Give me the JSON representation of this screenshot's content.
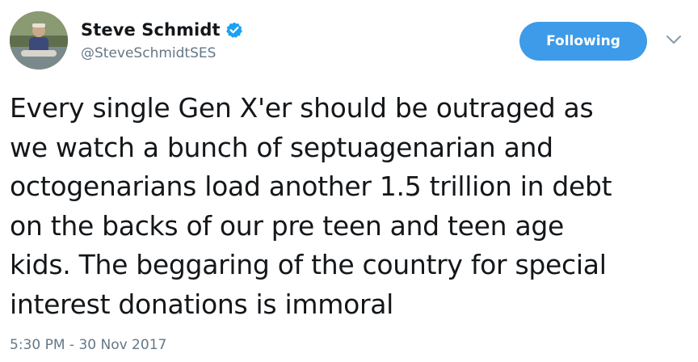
{
  "author": {
    "display_name": "Steve Schmidt",
    "handle": "@SteveSchmidtSES",
    "verified_icon": "verified-badge-icon",
    "avatar": "profile-photo"
  },
  "actions": {
    "follow_label": "Following",
    "more_icon": "chevron-down-icon"
  },
  "tweet": {
    "text": "Every single Gen X'er should be outraged as\nwe watch a bunch of septuagenarian and\noctogenarians load another 1.5 trillion in debt\non the backs of our pre teen and teen age\nkids. The beggaring of the country for special\ninterest donations is immoral",
    "timestamp": "5:30 PM - 30 Nov 2017"
  },
  "colors": {
    "accent": "#3d9be9",
    "text_primary": "#14171a",
    "text_secondary": "#657786"
  }
}
